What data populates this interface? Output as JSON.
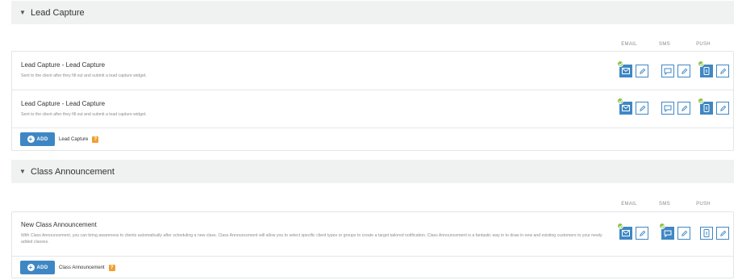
{
  "sections": [
    {
      "title": "Lead Capture",
      "columns": [
        "EMAIL",
        "SMS",
        "PUSH"
      ],
      "rows": [
        {
          "name": "Lead Capture - Lead Capture",
          "description": "Sent to the client after they fill out and submit a lead capture widget."
        },
        {
          "name": "Lead Capture - Lead Capture",
          "description": "Sent to the client after they fill out and submit a lead capture widget."
        }
      ],
      "add_label": "ADD",
      "add_type": "Lead Capture",
      "help": "?"
    },
    {
      "title": "Class Announcement",
      "columns": [
        "EMAIL",
        "SMS",
        "PUSH"
      ],
      "rows": [
        {
          "name": "New Class Announcement",
          "description": "With Class Announcement, you can bring awareness to clients automatically after scheduling a new class. Class Announcement will allow you to select specific client types or groups to create a target tailored notification. Class Announcement is a fantastic way in to draw in new and existing customers to your newly added classes."
        }
      ],
      "add_label": "ADD",
      "add_type": "Class Announcement",
      "help": "?"
    }
  ],
  "colors": {
    "accent": "#3f87c4",
    "enabled_check": "#8bc34a",
    "help": "#f0a030",
    "header_bg": "#f0f1f1"
  },
  "icons": {
    "collapse": "caret-down-icon",
    "email": "envelope-icon",
    "sms": "chat-bubble-icon",
    "push": "mobile-notification-icon",
    "edit": "pencil-icon",
    "enabled": "check-icon",
    "add": "plus-icon",
    "help": "question-icon"
  }
}
